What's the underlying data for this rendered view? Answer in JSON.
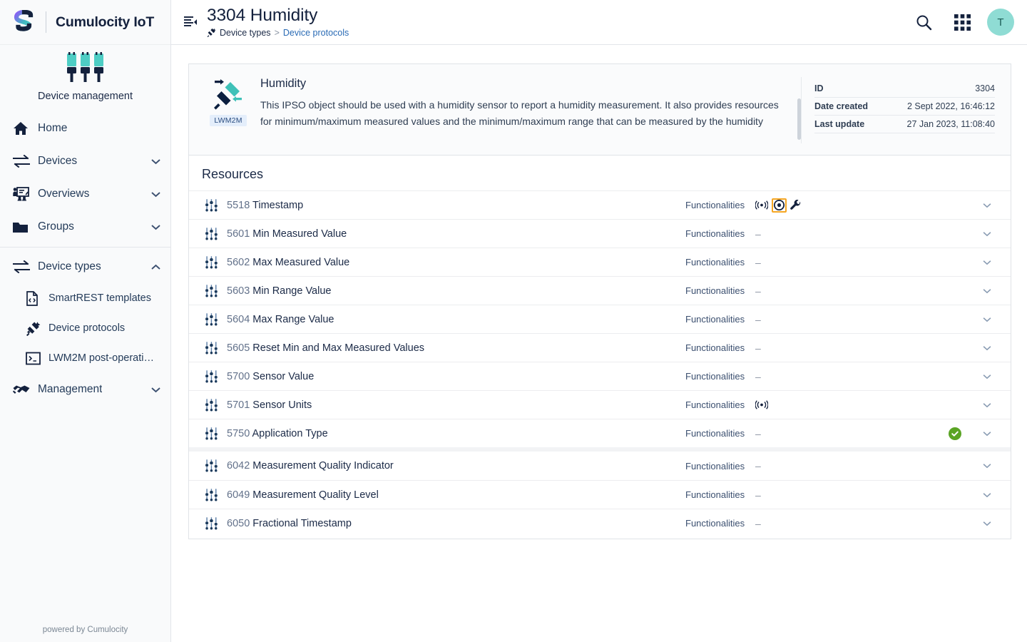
{
  "brand": {
    "name": "Cumulocity IoT",
    "logo_icon": "cumulocity-s-logo",
    "app_icon": "device-management-icon",
    "app_name": "Device management",
    "footer": "powered by Cumulocity"
  },
  "sidebar": {
    "items": [
      {
        "label": "Home",
        "icon": "home-icon",
        "caret": false,
        "sub": false
      },
      {
        "label": "Devices",
        "icon": "transfer-icon",
        "caret": true,
        "sub": false
      },
      {
        "label": "Overviews",
        "icon": "presentation-icon",
        "caret": true,
        "sub": false
      },
      {
        "label": "Groups",
        "icon": "folder-icon",
        "caret": true,
        "sub": false
      }
    ],
    "section": {
      "label": "Device types",
      "icon": "transfer-icon",
      "caret": "up",
      "children": [
        {
          "label": "SmartREST templates",
          "icon": "file-code-icon"
        },
        {
          "label": "Device protocols",
          "icon": "plug-connect-icon"
        },
        {
          "label": "LWM2M post-operatio...",
          "icon": "terminal-icon"
        }
      ]
    },
    "management": {
      "label": "Management",
      "icon": "handshake-icon",
      "caret": true
    }
  },
  "topbar": {
    "collapse_icon": "collapse-sidebar-icon",
    "title": "3304 Humidity",
    "breadcrumb": {
      "icon": "plug-connect-icon",
      "root": "Device types",
      "separator": ">",
      "current": "Device protocols"
    },
    "actions": [
      {
        "name": "search-icon",
        "label": "Search"
      },
      {
        "name": "app-switcher-icon",
        "label": "Applications"
      }
    ],
    "avatar_initial": "T"
  },
  "description_card": {
    "protocol_tag": "LWM2M",
    "protocol_icon": "lwm2m-plug-icon",
    "title": "Humidity",
    "text": "This IPSO object should be used with a humidity sensor to report a humidity measurement.  It also provides resources for minimum/maximum measured values and the minimum/maximum range that can be measured by the humidity sensor. An",
    "meta": [
      {
        "key": "ID",
        "value": "3304"
      },
      {
        "key": "Date created",
        "value": "2 Sept 2022, 16:46:12"
      },
      {
        "key": "Last update",
        "value": "27 Jan 2023, 11:08:40"
      }
    ]
  },
  "resources": {
    "title": "Resources",
    "functionalities_label": "Functionalities",
    "dash": "–",
    "rows": [
      {
        "id": "5518",
        "name": "Timestamp",
        "icon": "sliders-icon",
        "functionalities": [
          "broadcast-icon",
          "observe-eye-icon",
          "wrench-icon"
        ],
        "highlighted_icon": "observe-eye-icon",
        "status": null,
        "gap_above": false
      },
      {
        "id": "5601",
        "name": "Min Measured Value",
        "icon": "sliders-icon",
        "functionalities": [],
        "highlighted_icon": null,
        "status": null,
        "gap_above": false
      },
      {
        "id": "5602",
        "name": "Max Measured Value",
        "icon": "sliders-icon",
        "functionalities": [],
        "highlighted_icon": null,
        "status": null,
        "gap_above": false
      },
      {
        "id": "5603",
        "name": "Min Range Value",
        "icon": "sliders-icon",
        "functionalities": [],
        "highlighted_icon": null,
        "status": null,
        "gap_above": false
      },
      {
        "id": "5604",
        "name": "Max Range Value",
        "icon": "sliders-icon",
        "functionalities": [],
        "highlighted_icon": null,
        "status": null,
        "gap_above": false
      },
      {
        "id": "5605",
        "name": "Reset Min and Max Measured Values",
        "icon": "sliders-icon",
        "functionalities": [],
        "highlighted_icon": null,
        "status": null,
        "gap_above": false
      },
      {
        "id": "5700",
        "name": "Sensor Value",
        "icon": "sliders-icon",
        "functionalities": [],
        "highlighted_icon": null,
        "status": null,
        "gap_above": false
      },
      {
        "id": "5701",
        "name": "Sensor Units",
        "icon": "sliders-icon",
        "functionalities": [
          "broadcast-icon"
        ],
        "highlighted_icon": null,
        "status": null,
        "gap_above": false
      },
      {
        "id": "5750",
        "name": "Application Type",
        "icon": "sliders-icon",
        "functionalities": [],
        "highlighted_icon": null,
        "status": "check",
        "gap_above": false
      },
      {
        "id": "6042",
        "name": "Measurement Quality Indicator",
        "icon": "sliders-icon",
        "functionalities": [],
        "highlighted_icon": null,
        "status": null,
        "gap_above": true
      },
      {
        "id": "6049",
        "name": "Measurement Quality Level",
        "icon": "sliders-icon",
        "functionalities": [],
        "highlighted_icon": null,
        "status": null,
        "gap_above": false
      },
      {
        "id": "6050",
        "name": "Fractional Timestamp",
        "icon": "sliders-icon",
        "functionalities": [],
        "highlighted_icon": null,
        "status": null,
        "gap_above": false
      }
    ]
  },
  "colors": {
    "brand_dark": "#14213d",
    "accent_teal": "#4ecdc4",
    "link_blue": "#2a6bb5",
    "highlight_orange": "#f5a623",
    "status_green": "#5aa424",
    "sidebar_bg": "#f9fafb"
  }
}
